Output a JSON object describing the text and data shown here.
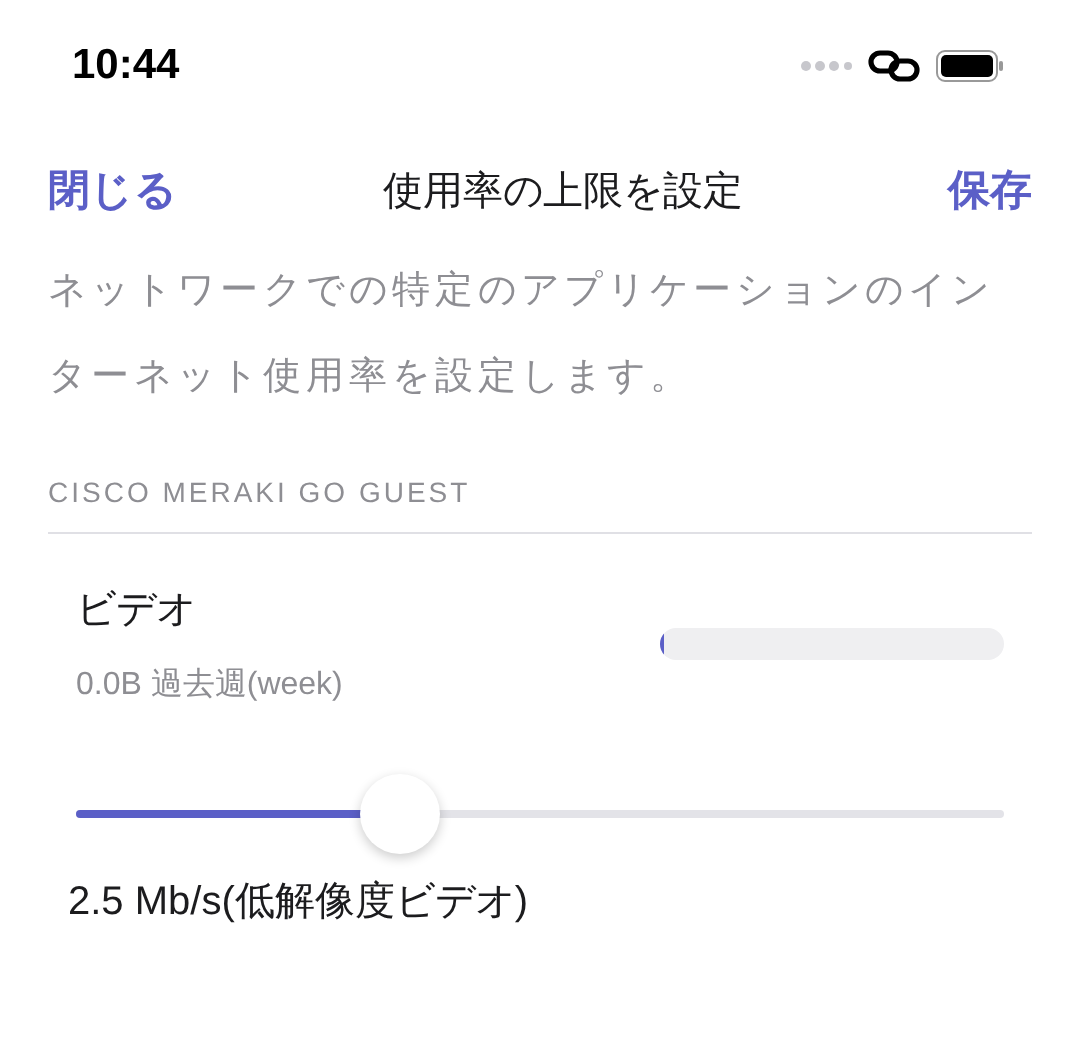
{
  "status_bar": {
    "time": "10:44"
  },
  "nav": {
    "close": "閉じる",
    "title": "使用率の上限を設定",
    "save": "保存"
  },
  "description": "ネットワークでの特定のアプリケーションのインターネット使用率を設定します。",
  "section": {
    "header": "CISCO MERAKI GO GUEST",
    "items": [
      {
        "name": "ビデオ",
        "usage": "0.0B 過去週(week)",
        "usage_bar": {
          "level": 0.01
        },
        "limit": {
          "level": 0.35
        },
        "reading": "2.5 Mb/s(低解像度ビデオ)"
      }
    ]
  }
}
